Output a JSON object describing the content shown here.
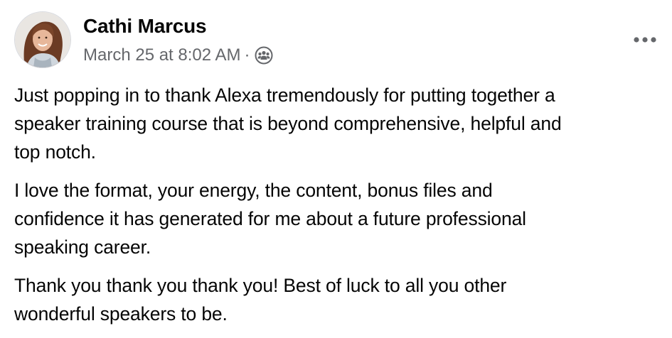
{
  "post": {
    "author": {
      "name": "Cathi Marcus",
      "avatar_icon": "profile-photo"
    },
    "timestamp": "March 25 at 8:02 AM",
    "separator": "·",
    "audience_icon": "group-audience-icon",
    "more_icon": "more-options-icon",
    "paragraphs": [
      {
        "lines": [
          "Just popping in to thank Alexa tremendously for putting together a",
          "speaker training course that is beyond comprehensive, helpful and",
          "top notch."
        ]
      },
      {
        "lines": [
          "I love the format, your energy, the content, bonus files and",
          "confidence it has generated for me about a future professional",
          "speaking career."
        ]
      },
      {
        "lines": [
          "Thank you thank you thank you! Best of luck to all you other",
          "wonderful speakers to be."
        ]
      }
    ]
  },
  "colors": {
    "text_primary": "#050505",
    "text_secondary": "#65676b",
    "background": "#ffffff"
  }
}
